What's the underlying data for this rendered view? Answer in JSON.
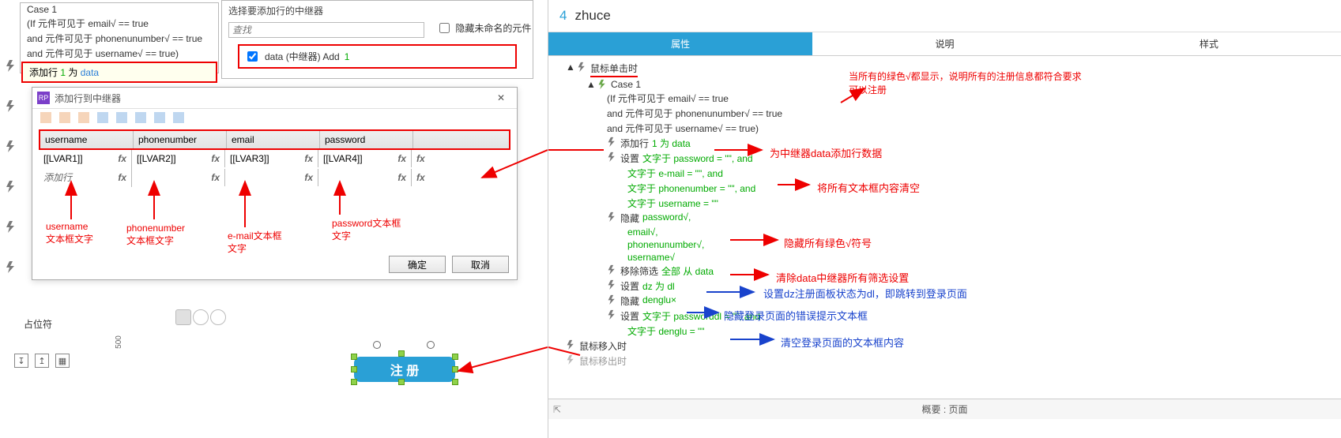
{
  "left": {
    "case": {
      "title": "Case 1",
      "cond1": "(If 元件可见于 email√ == true",
      "cond2": "and 元件可见于 phonenunumber√ == true",
      "cond3": "and 元件可见于 username√ == true)",
      "add_label": "添加行",
      "add_num": "1",
      "add_mid": "为",
      "add_data": "data"
    },
    "repeater": {
      "title": "选择要添加行的中继器",
      "search_placeholder": "查找",
      "hide_label": "隐藏未命名的元件",
      "row_main": "data (中继器) Add",
      "row_suffix": "1"
    },
    "dialog": {
      "title": "添加行到中继器",
      "columns": [
        "username",
        "phonenumber",
        "email",
        "password"
      ],
      "cells": [
        "[[LVAR1]]",
        "[[LVAR2]]",
        "[[LVAR3]]",
        "[[LVAR4]]"
      ],
      "addrow_label": "添加行",
      "fx": "fx",
      "ok": "确定",
      "cancel": "取消"
    },
    "annotations": {
      "a1_line1": "username",
      "a1_line2": "文本框文字",
      "a2_line1": "phonenumber",
      "a2_line2": "文本框文字",
      "a3_line1": "e-mail文本框",
      "a3_line2": "文字",
      "a4_line1": "password文本框",
      "a4_line2": "文字"
    },
    "placeholder": "占位符",
    "ruler": "500",
    "register_btn": "注 册"
  },
  "right": {
    "page_num": "4",
    "page_name": "zhuce",
    "tabs": [
      "属性",
      "说明",
      "样式"
    ],
    "tree": {
      "event": "鼠标单击时",
      "case_title": "Case 1",
      "case_c1": "(If 元件可见于 email√ == true",
      "case_c2": "and 元件可见于 phonenunumber√ == true",
      "case_c3": "and 元件可见于 username√ == true)",
      "add_prefix": "添加行",
      "add_green": "1 为 data",
      "set_prefix": "设置",
      "set_g1": "文字于 password = \"\", and",
      "set_g2": "文字于 e-mail = \"\", and",
      "set_g3": "文字于 phonenumber = \"\", and",
      "set_g4": "文字于 username = \"\"",
      "hide_prefix": "隐藏",
      "hide_g1": "password√,",
      "hide_g2": "email√,",
      "hide_g3": "phonenunumber√,",
      "hide_g4": "username√",
      "filter_prefix": "移除筛选",
      "filter_green": "全部 从 data",
      "setdz_prefix": "设置",
      "setdz_green": "dz 为 dl",
      "hidedl_prefix": "隐藏",
      "hidedl_green": "denglu×",
      "setpwd_prefix": "设置",
      "setpwd_g1": "文字于 passworddl = \"\", and",
      "setpwd_g2": "文字于 denglu = \"\"",
      "hover": "鼠标移入时",
      "leave": "鼠标移出时"
    },
    "annotations": {
      "r1": "当所有的绿色√都显示，说明所有的注册信息都符合要求",
      "r1b": "可以注册",
      "r2": "为中继器data添加行数据",
      "r3": "将所有文本框内容清空",
      "r4": "隐藏所有绿色√符号",
      "r5": "清除data中继器所有筛选设置",
      "b1": "设置dz注册面板状态为dl，即跳转到登录页面",
      "b2": "隐藏登录页面的错误提示文本框",
      "b3": "清空登录页面的文本框内容"
    },
    "bottom": "概要 : 页面"
  }
}
